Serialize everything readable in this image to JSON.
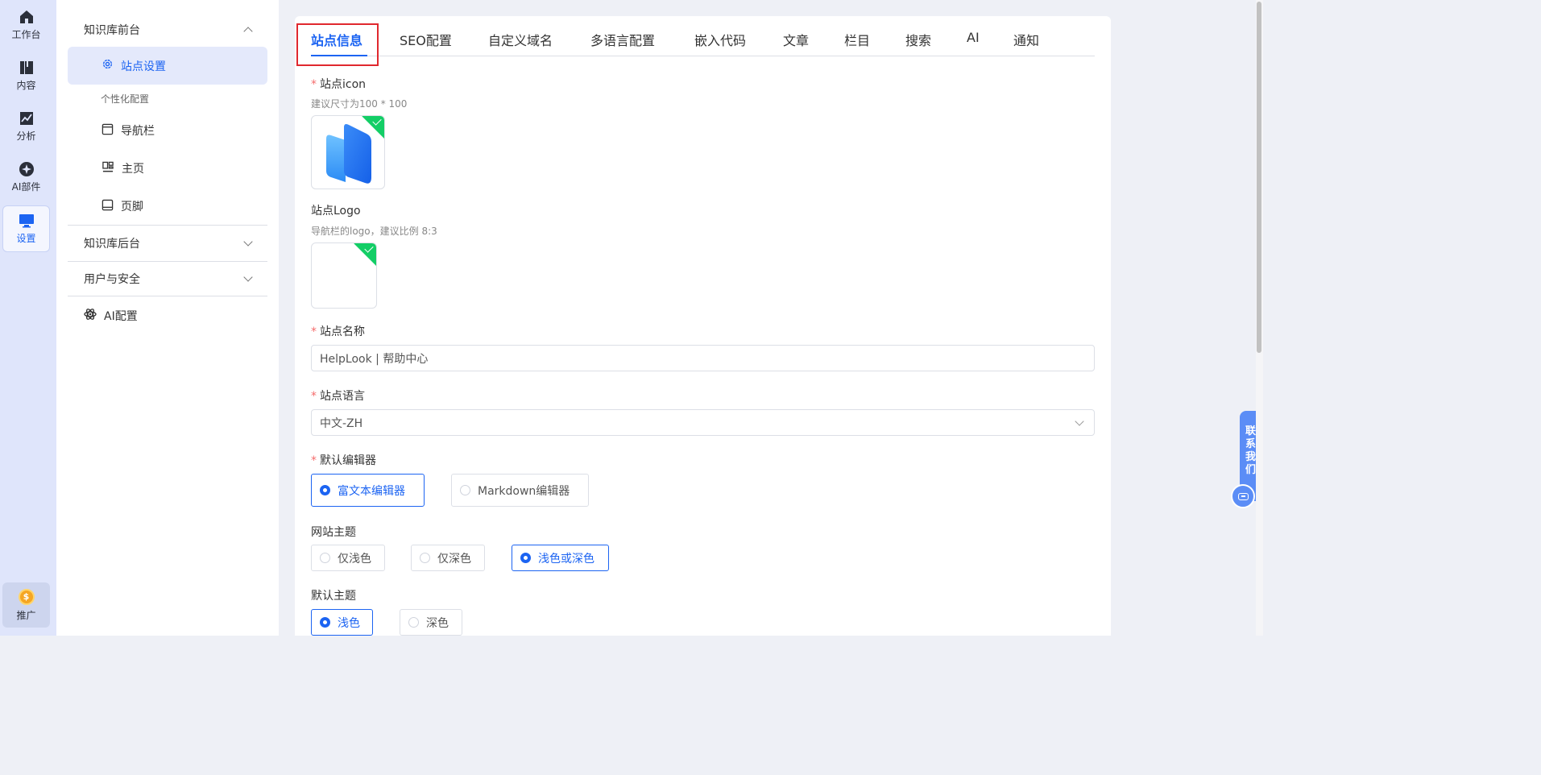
{
  "rail": {
    "items": [
      {
        "label": "工作台",
        "icon": "home-icon"
      },
      {
        "label": "内容",
        "icon": "book-icon"
      },
      {
        "label": "分析",
        "icon": "chart-icon"
      },
      {
        "label": "AI部件",
        "icon": "ai-widget-icon"
      },
      {
        "label": "设置",
        "icon": "monitor-icon"
      }
    ],
    "promo_label": "推广"
  },
  "sidebar": {
    "section_front": "知识库前台",
    "active_item": "站点设置",
    "group_label": "个性化配置",
    "items": [
      {
        "label": "导航栏"
      },
      {
        "label": "主页"
      },
      {
        "label": "页脚"
      }
    ],
    "section_back": "知识库后台",
    "section_user": "用户与安全",
    "ai_config": "AI配置"
  },
  "tabs": [
    "站点信息",
    "SEO配置",
    "自定义域名",
    "多语言配置",
    "嵌入代码",
    "文章",
    "栏目",
    "搜索",
    "AI",
    "通知"
  ],
  "form": {
    "required_mark": "*",
    "site_icon_label": "站点icon",
    "site_icon_hint": "建议尺寸为100 * 100",
    "site_logo_label": "站点Logo",
    "site_logo_hint": "导航栏的logo，建议比例 8:3",
    "site_name_label": "站点名称",
    "site_name_value": "HelpLook | 帮助中心",
    "site_language_label": "站点语言",
    "site_language_value": "中文-ZH",
    "editor_label": "默认编辑器",
    "editor_options": [
      "富文本编辑器",
      "Markdown编辑器"
    ],
    "editor_selected": "富文本编辑器",
    "theme_label": "网站主题",
    "theme_options": [
      "仅浅色",
      "仅深色",
      "浅色或深色"
    ],
    "theme_selected": "浅色或深色",
    "default_theme_label": "默认主题",
    "default_theme_options": [
      "浅色",
      "深色"
    ],
    "default_theme_selected": "浅色"
  },
  "contact": {
    "label": "联系我们",
    "icon": "chat-icon"
  },
  "colors": {
    "accent": "#1c64f2",
    "required": "#f56c6c",
    "success": "#13ce66",
    "highlight_box": "#e0282e"
  }
}
